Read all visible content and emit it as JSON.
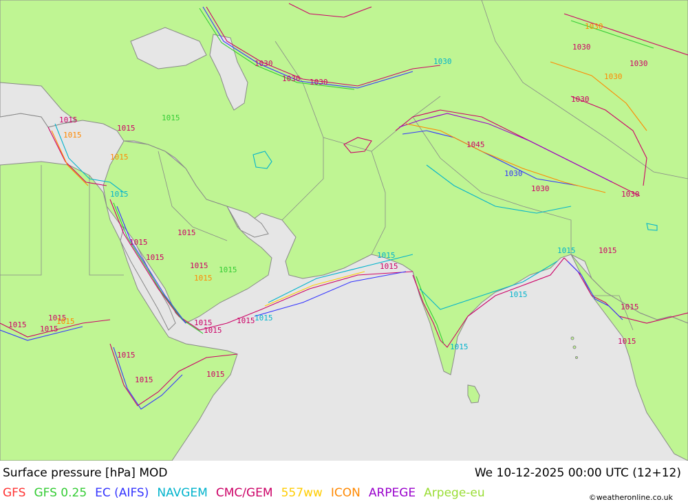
{
  "title": "Surface pressure [hPa] MOD",
  "datetime": "We 10-12-2025 00:00 UTC (12+12)",
  "credit": "©weatheronline.co.uk",
  "legend": [
    {
      "label": "GFS",
      "color": "#ff3333"
    },
    {
      "label": "GFS 0.25",
      "color": "#33cc33"
    },
    {
      "label": "EC (AIFS)",
      "color": "#3333ff"
    },
    {
      "label": "NAVGEM",
      "color": "#00b3cc"
    },
    {
      "label": "CMC/GEM",
      "color": "#cc0066"
    },
    {
      "label": "557ww",
      "color": "#ffcc00"
    },
    {
      "label": "ICON",
      "color": "#ff8800"
    },
    {
      "label": "ARPEGE",
      "color": "#9900cc"
    },
    {
      "label": "Arpege-eu",
      "color": "#99dd33"
    }
  ],
  "colors": {
    "land": "#bff593",
    "sea": "#e6e6e6",
    "border": "#888888"
  },
  "isobar_labels": [
    {
      "text": "1030",
      "color": "#cc0066"
    },
    {
      "text": "1030",
      "color": "#cc0066"
    },
    {
      "text": "1030",
      "color": "#00b3cc"
    },
    {
      "text": "1030",
      "color": "#cc0066"
    },
    {
      "text": "1030",
      "color": "#ff8800"
    },
    {
      "text": "1030",
      "color": "#cc0066"
    },
    {
      "text": "1030",
      "color": "#cc0066"
    },
    {
      "text": "1030",
      "color": "#ff8800"
    },
    {
      "text": "1030",
      "color": "#cc0066"
    },
    {
      "text": "1045",
      "color": "#cc0066"
    },
    {
      "text": "1030",
      "color": "#3333ff"
    },
    {
      "text": "1030",
      "color": "#cc0066"
    },
    {
      "text": "1030",
      "color": "#cc0066"
    },
    {
      "text": "1015",
      "color": "#cc0066"
    },
    {
      "text": "1015",
      "color": "#ff8800"
    },
    {
      "text": "1015",
      "color": "#cc0066"
    },
    {
      "text": "1015",
      "color": "#33cc33"
    },
    {
      "text": "1015",
      "color": "#ff8800"
    },
    {
      "text": "1015",
      "color": "#00b3cc"
    },
    {
      "text": "1015",
      "color": "#cc0066"
    },
    {
      "text": "1015",
      "color": "#cc0066"
    },
    {
      "text": "1015",
      "color": "#cc0066"
    },
    {
      "text": "1015",
      "color": "#33cc33"
    },
    {
      "text": "1015",
      "color": "#cc0066"
    },
    {
      "text": "1015",
      "color": "#ff8800"
    },
    {
      "text": "1015",
      "color": "#00b3cc"
    },
    {
      "text": "1015",
      "color": "#cc0066"
    },
    {
      "text": "1015",
      "color": "#cc0066"
    },
    {
      "text": "1015",
      "color": "#cc0066"
    },
    {
      "text": "1015",
      "color": "#00b3cc"
    },
    {
      "text": "1015",
      "color": "#00b3cc"
    },
    {
      "text": "1015",
      "color": "#cc0066"
    },
    {
      "text": "1015",
      "color": "#00b3cc"
    },
    {
      "text": "1015",
      "color": "#cc0066"
    },
    {
      "text": "1015",
      "color": "#cc0066"
    },
    {
      "text": "1015",
      "color": "#00b3cc"
    },
    {
      "text": "1015",
      "color": "#cc0066"
    },
    {
      "text": "1015",
      "color": "#cc0066"
    },
    {
      "text": "1015",
      "color": "#cc0066"
    },
    {
      "text": "1015",
      "color": "#cc0066"
    },
    {
      "text": "1015",
      "color": "#cc0066"
    },
    {
      "text": "1015",
      "color": "#cc0066"
    },
    {
      "text": "1015",
      "color": "#ff8800"
    },
    {
      "text": "1015",
      "color": "#cc0066"
    }
  ]
}
